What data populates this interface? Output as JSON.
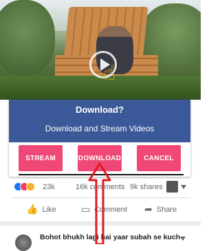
{
  "dialog": {
    "title": "Download?",
    "subtitle": "Download and Stream Videos",
    "buttons": {
      "stream": "STREAM",
      "download": "DOWNLOAD",
      "cancel": "CANCEL"
    }
  },
  "stats": {
    "reactions": "23k",
    "comments": "16k comments",
    "shares": "9k shares"
  },
  "actions": {
    "like": "Like",
    "comment": "Comment",
    "share": "Share"
  },
  "next_post": {
    "text": "Bohot bhukh lagi hai yaar subah se kuch"
  },
  "colors": {
    "brand_blue": "#3b5998",
    "button_pink": "#ef4776",
    "arrow_red": "#e0191b"
  },
  "icons": [
    "play-icon",
    "hand-pointer-icon",
    "like-reaction-icon",
    "love-reaction-icon",
    "haha-reaction-icon",
    "thumbs-up-icon",
    "comment-icon",
    "share-icon",
    "chevron-down-icon"
  ]
}
